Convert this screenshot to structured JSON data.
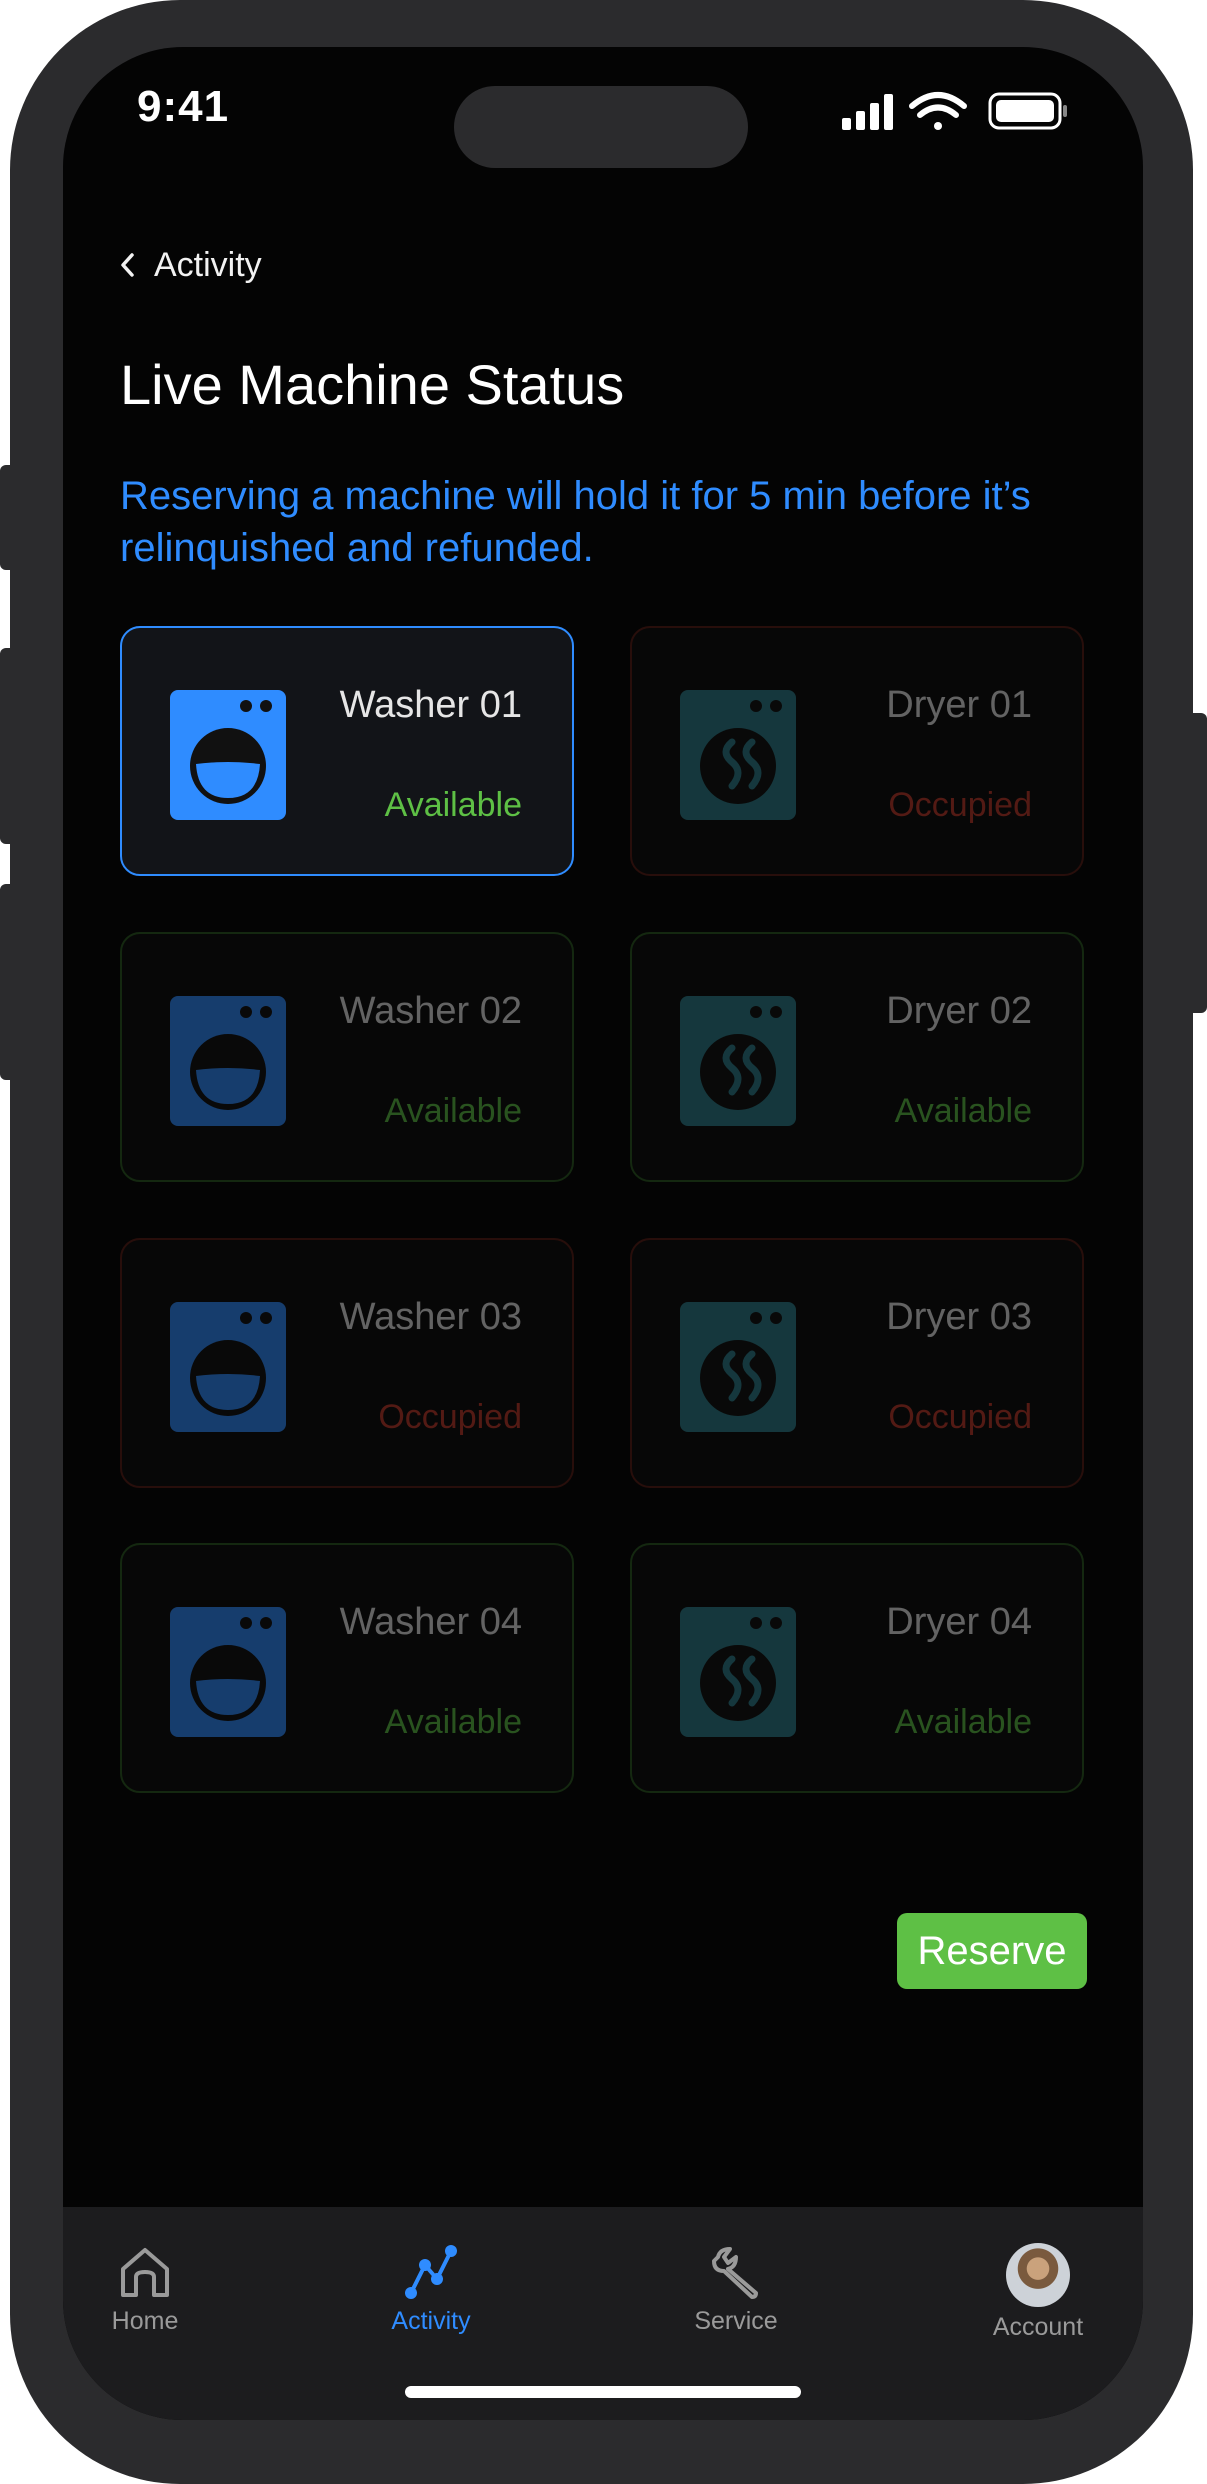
{
  "status_bar": {
    "time": "9:41"
  },
  "nav": {
    "back_label": "Activity"
  },
  "page": {
    "title": "Live Machine Status",
    "subtitle": "Reserving a machine will hold it for 5 min before it’s relinquished and refunded."
  },
  "colors": {
    "accent": "#2f8cff",
    "available": "#5ec045",
    "occupied": "#c0392b",
    "washer_icon": "#2f8cff",
    "dryer_icon": "#2e7f8c"
  },
  "machines": [
    {
      "name": "Washer 01",
      "status": "Available",
      "type": "washer",
      "selected": true
    },
    {
      "name": "Dryer 01",
      "status": "Occupied",
      "type": "dryer",
      "selected": false
    },
    {
      "name": "Washer 02",
      "status": "Available",
      "type": "washer",
      "selected": false
    },
    {
      "name": "Dryer 02",
      "status": "Available",
      "type": "dryer",
      "selected": false
    },
    {
      "name": "Washer 03",
      "status": "Occupied",
      "type": "washer",
      "selected": false
    },
    {
      "name": "Dryer 03",
      "status": "Occupied",
      "type": "dryer",
      "selected": false
    },
    {
      "name": "Washer 04",
      "status": "Available",
      "type": "washer",
      "selected": false
    },
    {
      "name": "Dryer 04",
      "status": "Available",
      "type": "dryer",
      "selected": false
    }
  ],
  "actions": {
    "reserve_label": "Reserve"
  },
  "tab_bar": {
    "items": [
      {
        "label": "Home",
        "icon": "home-icon",
        "active": false
      },
      {
        "label": "Activity",
        "icon": "activity-icon",
        "active": true
      },
      {
        "label": "Service",
        "icon": "wrench-icon",
        "active": false
      },
      {
        "label": "Account",
        "icon": "avatar",
        "active": false
      }
    ]
  }
}
